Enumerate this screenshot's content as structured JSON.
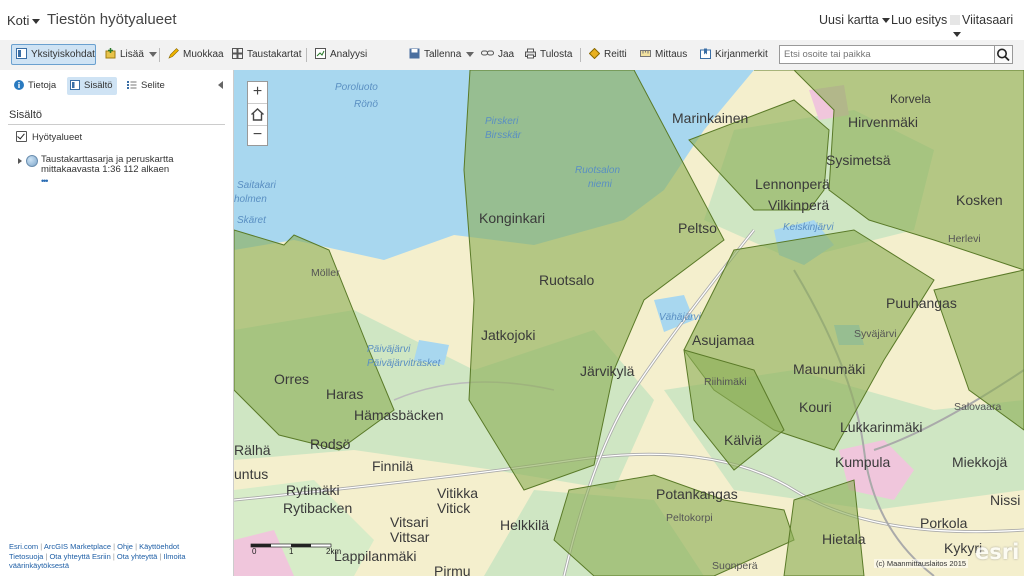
{
  "header": {
    "home_label": "Koti",
    "title": "Tiestön hyötyalueet",
    "new_map_label": "Uusi kartta",
    "create_presentation_label": "Luo esitys",
    "user_label": "Viitasaari"
  },
  "toolbar": {
    "details": "Yksityiskohdat",
    "add": "Lisää",
    "edit": "Muokkaa",
    "basemap": "Taustakartat",
    "analysis": "Analyysi",
    "save": "Tallenna",
    "share": "Jaa",
    "print": "Tulosta",
    "directions": "Reitti",
    "measure": "Mittaus",
    "bookmarks": "Kirjanmerkit"
  },
  "search": {
    "placeholder": "Etsi osoite tai paikka"
  },
  "panel": {
    "tabs": [
      "Tietoja",
      "Sisältö",
      "Selite"
    ],
    "section_title": "Sisältö",
    "layer_name": "Hyötyalueet",
    "basemap_line1": "Taustakarttasarja ja peruskartta",
    "basemap_line2": "mittakaavasta 1:36 112 alkaen",
    "more": "•••",
    "footer": {
      "esri": "Esri.com",
      "marketplace": "ArcGIS Marketplace",
      "help": "Ohje",
      "terms": "Käyttöehdot",
      "privacy": "Tietosuoja",
      "contact_esri": "Ota yhteyttä Esriin",
      "contact": "Ota yhteyttä",
      "report": "Ilmoita",
      "report2": "väärinkäytöksestä"
    }
  },
  "map": {
    "zoom_in": "+",
    "zoom_out": "−",
    "labels": {
      "porluoto": "Poroluoto",
      "rono": "Rönö",
      "pirskeri": "Pirskeri",
      "birsskar": "Birsskär",
      "ruotsalon": "Ruotsalon",
      "niemi": "niemi",
      "marinkainen": "Marinkainen",
      "korvela": "Korvela",
      "hirvenmaki": "Hirvenmäki",
      "sysimetsa": "Sysimetsä",
      "lennonpera": "Lennonperä",
      "vilkinpera": "Vilkinperä",
      "keiskinjarvi": "Keiskinjärvi",
      "kosken": "Kosken",
      "herlevi": "Herlevi",
      "saitakari": "Saitakari",
      "holmen": "holmen",
      "skaret": "Skäret",
      "konginkari": "Konginkari",
      "peltso": "Peltso",
      "ruotsalo": "Ruotsalo",
      "moller": "Möller",
      "puuhangas": "Puuhangas",
      "syvajarvi": "Syväjärvi",
      "vahajarvi": "Vähäjärvi",
      "jatkojoki": "Jatkojoki",
      "asujamaa": "Asujamaa",
      "paivajarvi": "Päiväjärvi",
      "paivajarvitrasket": "Päiväjärviträsket",
      "maunumaki": "Maunumäki",
      "jarvikyla": "Järvikylä",
      "riihimaki": "Riihimäki",
      "orres": "Orres",
      "haras": "Haras",
      "kouri": "Kouri",
      "salovaara": "Salovaara",
      "hamasbacken": "Hämasbäcken",
      "lukkarinmaki": "Lukkarinmäki",
      "rodso": "Rodsö",
      "kalvia": "Kälviä",
      "ralha": "Rälhä",
      "finnila": "Finnilä",
      "kumpula": "Kumpula",
      "miekkoja": "Miekkojä",
      "untus": "untus",
      "rytimaki": "Rytimäki",
      "rytibacken": "Rytibacken",
      "vitikka": "Vitikka",
      "vitick": "Vitick",
      "potankangas": "Potankangas",
      "nissi": "Nissi",
      "peltokorpi": "Peltokorpi",
      "helkkila": "Helkkilä",
      "vitsari": "Vitsari",
      "vittsar": "Vittsar",
      "lappilanmaki": "Lappilanmäki",
      "porkola": "Porkola",
      "hietala": "Hietala",
      "kykyri": "Kykyri",
      "suonpera": "Suonperä",
      "pirmu": "Pirmu"
    },
    "scale_labels": [
      "0",
      "1",
      "2km"
    ],
    "copyright": "(c) Maanmittauslaitos 2015",
    "logo": "esri"
  },
  "colors": {
    "water": "#a8d7ef",
    "land": "#f4efcd",
    "forest": "#cfe6c3",
    "field": "#f5f0c2",
    "polygon_fill": "#8dae57",
    "polygon_stroke": "#5a7a28",
    "accent": "#6aa0cf"
  }
}
